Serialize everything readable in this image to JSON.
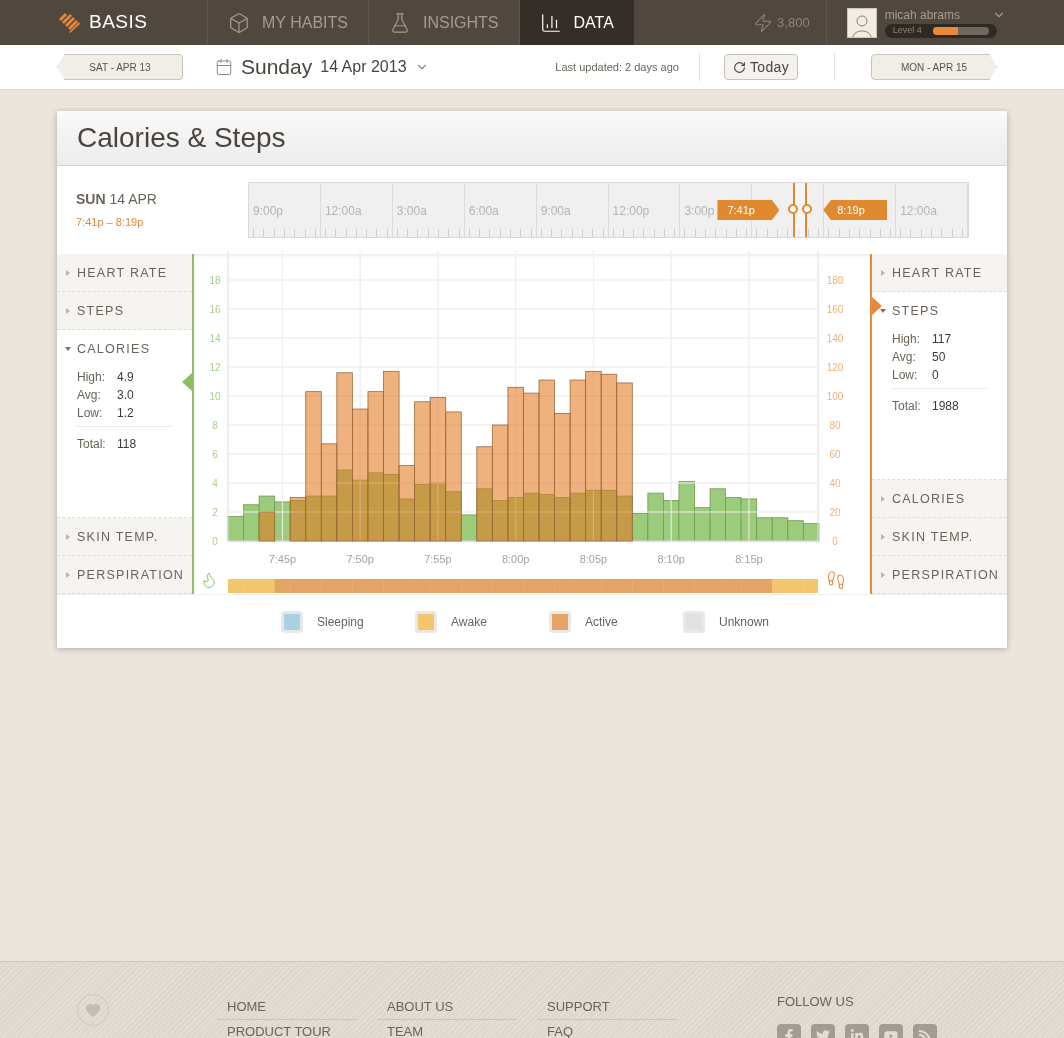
{
  "header": {
    "logo": "BASIS",
    "nav": [
      {
        "label": "MY HABITS",
        "selected": false
      },
      {
        "label": "INSIGHTS",
        "selected": false
      },
      {
        "label": "DATA",
        "selected": true
      }
    ],
    "points": "3,800",
    "user": {
      "name": "micah abrams",
      "level_label": "Level 4",
      "level": 0.45
    }
  },
  "date_bar": {
    "prev": "SAT - APR 13",
    "weekday": "Sunday",
    "date": "14 Apr 2013",
    "updated": "Last updated: 2 days ago",
    "today": "Today",
    "next": "MON - APR 15"
  },
  "card": {
    "title": "Calories & Steps",
    "range": {
      "day": "SUN",
      "date": "14 APR",
      "span": "7:41p – 8:19p"
    },
    "ruler": [
      {
        "label": "9:00p"
      },
      {
        "label": "12:00a"
      },
      {
        "label": "3:00a"
      },
      {
        "label": "6:00a"
      },
      {
        "label": "9:00a"
      },
      {
        "label": "12:00p"
      },
      {
        "label": "3:00p"
      },
      {
        "covered": true
      },
      {
        "covered": true
      },
      {
        "label": "12:00a"
      }
    ],
    "flags": {
      "start": "7:41p",
      "end": "8:19p"
    },
    "left_metrics": [
      {
        "label": "HEART RATE",
        "expanded": false
      },
      {
        "label": "STEPS",
        "expanded": false
      },
      {
        "label": "CALORIES",
        "expanded": true,
        "stats": [
          {
            "label": "High:",
            "value": "4.9"
          },
          {
            "label": "Avg:",
            "value": "3.0"
          },
          {
            "label": "Low:",
            "value": "1.2"
          }
        ],
        "total": {
          "label": "Total:",
          "value": "118"
        }
      },
      {
        "label": "SKIN TEMP.",
        "expanded": false
      },
      {
        "label": "PERSPIRATION",
        "expanded": false
      }
    ],
    "right_metrics": [
      {
        "label": "HEART RATE",
        "expanded": false
      },
      {
        "label": "STEPS",
        "expanded": true,
        "stats": [
          {
            "label": "High:",
            "value": "117"
          },
          {
            "label": "Avg:",
            "value": "50"
          },
          {
            "label": "Low:",
            "value": "0"
          }
        ],
        "total": {
          "label": "Total:",
          "value": "1988"
        }
      },
      {
        "label": "CALORIES",
        "expanded": false
      },
      {
        "label": "SKIN TEMP.",
        "expanded": false
      },
      {
        "label": "PERSPIRATION",
        "expanded": false
      }
    ],
    "calories_chart": {
      "chart_data": {
        "type": "bar",
        "categories": [
          null,
          null,
          null,
          "7:45p",
          null,
          null,
          null,
          null,
          "7:50p",
          null,
          null,
          null,
          null,
          "7:55p",
          null,
          null,
          null,
          null,
          "8:00p",
          null,
          null,
          null,
          null,
          "8:05p",
          null,
          null,
          null,
          null,
          "8:10p",
          null,
          null,
          null,
          null,
          "8:15p",
          null,
          null,
          null,
          null
        ],
        "ylim": [
          0,
          20
        ],
        "yticks": [
          0,
          2,
          4,
          6,
          8,
          10,
          12,
          14,
          16,
          18
        ],
        "grid": true,
        "series": [
          {
            "color": "#9dcb7c",
            "values": [
              1.7,
              2.5,
              3.1,
              2.7,
              2.8,
              3.1,
              3.1,
              4.9,
              4.2,
              4.7,
              4.6,
              2.9,
              3.9,
              4.0,
              3.4,
              1.8,
              3.6,
              2.8,
              3.0,
              3.3,
              3.2,
              3.0,
              3.3,
              3.5,
              3.5,
              3.1,
              1.9,
              3.3,
              2.8,
              4.1,
              2.3,
              3.6,
              3.0,
              2.9,
              1.6,
              1.6,
              1.4,
              1.2
            ]
          }
        ]
      }
    },
    "steps_chart": {
      "chart_data": {
        "type": "bar",
        "ylim": [
          0,
          200
        ],
        "yticks": [
          0,
          20,
          40,
          60,
          80,
          100,
          120,
          140,
          160,
          180
        ],
        "grid": true,
        "series": [
          {
            "color": "#e47921",
            "values": [
              0,
              0,
              20,
              0,
              30,
              103,
              67,
              116,
              91,
              103,
              117,
              52,
              96,
              99,
              89,
              0,
              65,
              80,
              106,
              102,
              111,
              88,
              111,
              117,
              115,
              109,
              0,
              0,
              0,
              0,
              0,
              0,
              0,
              0,
              0,
              0,
              0,
              0
            ]
          }
        ]
      }
    },
    "activity": [
      {
        "kind": "awake"
      },
      {
        "kind": "awake"
      },
      {
        "kind": "awake"
      },
      {
        "kind": "active"
      },
      {
        "kind": "active"
      },
      {
        "kind": "active"
      },
      {
        "kind": "active"
      },
      {
        "kind": "active"
      },
      {
        "kind": "active"
      },
      {
        "kind": "active"
      },
      {
        "kind": "active"
      },
      {
        "kind": "active"
      },
      {
        "kind": "active"
      },
      {
        "kind": "active"
      },
      {
        "kind": "active"
      },
      {
        "kind": "active"
      },
      {
        "kind": "active"
      },
      {
        "kind": "active"
      },
      {
        "kind": "active"
      },
      {
        "kind": "active"
      },
      {
        "kind": "active"
      },
      {
        "kind": "active"
      },
      {
        "kind": "active"
      },
      {
        "kind": "active"
      },
      {
        "kind": "active"
      },
      {
        "kind": "active"
      },
      {
        "kind": "active"
      },
      {
        "kind": "active"
      },
      {
        "kind": "active"
      },
      {
        "kind": "active"
      },
      {
        "kind": "active"
      },
      {
        "kind": "active"
      },
      {
        "kind": "active"
      },
      {
        "kind": "active"
      },
      {
        "kind": "active"
      },
      {
        "kind": "awake"
      },
      {
        "kind": "awake"
      },
      {
        "kind": "awake"
      }
    ],
    "legend": [
      {
        "kind": "sleeping",
        "label": "Sleeping",
        "color": "#a8d1e1"
      },
      {
        "kind": "awake",
        "label": "Awake",
        "color": "#f3c56d"
      },
      {
        "kind": "active",
        "label": "Active",
        "color": "#e3a464"
      },
      {
        "kind": "unknown",
        "label": "Unknown",
        "color": "#e1e1e1"
      }
    ]
  },
  "footer": {
    "columns": [
      [
        "HOME",
        "PRODUCT TOUR"
      ],
      [
        "ABOUT US",
        "TEAM"
      ],
      [
        "SUPPORT",
        "FAQ"
      ]
    ],
    "follow": "FOLLOW US",
    "social": [
      {
        "kind": "facebook"
      },
      {
        "kind": "twitter"
      },
      {
        "kind": "linkedin"
      },
      {
        "kind": "youtube"
      },
      {
        "kind": "rss"
      }
    ]
  }
}
